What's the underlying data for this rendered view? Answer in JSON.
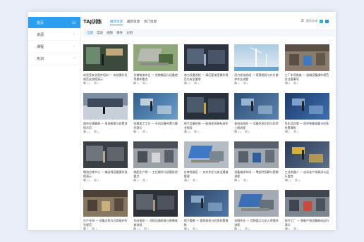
{
  "sidebar": {
    "items": [
      {
        "label": "首页",
        "badge": "15",
        "active": true
      },
      {
        "label": "资源",
        "chevron": "›"
      },
      {
        "label": "课程",
        "chevron": "›"
      },
      {
        "label": "实训",
        "chevron": "›"
      }
    ]
  },
  "header": {
    "title": "TAJ训练",
    "tabs": [
      "推荐资源",
      "最新资源",
      "热门资源"
    ],
    "tools_label": "显示方式",
    "colors": {
      "accent": "#2a9ff0",
      "tool_a": "#2ab3c0",
      "tool_b": "#2a8fe8"
    }
  },
  "filters": [
    "全部",
    "实验",
    "视频",
    "课件",
    "文档"
  ],
  "cards": [
    {
      "desc": "实验室安全防护培训 — 实验操作员规范化流程演示",
      "views": "12",
      "likes": "3",
      "scene": "room",
      "palette": [
        "#3b4a3c",
        "#6b8a6f",
        "#c2a878"
      ]
    },
    {
      "desc": "仓储物流作业 — 货物搬运与设备使用操作要点",
      "views": "8",
      "likes": "2",
      "scene": "aerial",
      "palette": [
        "#4d6b3f",
        "#8fa87a",
        "#b7b8b0"
      ]
    },
    {
      "desc": "电力设备巡检 — 高压配电室操作规范与安全要求",
      "views": "15",
      "likes": "4",
      "scene": "dark",
      "palette": [
        "#2b3340",
        "#56647a",
        "#9ab0c8"
      ]
    },
    {
      "desc": "风力发电机组 — 塔筒巡检与叶片维护作业流程",
      "views": "9",
      "likes": "1",
      "scene": "sky",
      "palette": [
        "#6aa4cc",
        "#a9cbe3",
        "#e9eef2"
      ]
    },
    {
      "desc": "工厂车间巡查 — 机械设备操作规范及注意事项",
      "views": "6",
      "likes": "2",
      "scene": "factory",
      "palette": [
        "#5a4f45",
        "#8a7b6a",
        "#3d7ac0"
      ]
    },
    {
      "desc": "城市交通事故 — 现场勘查与处置流程示范",
      "views": "11",
      "likes": "3",
      "scene": "street",
      "palette": [
        "#3d4a5c",
        "#7d8ea3",
        "#c7d0da"
      ]
    },
    {
      "desc": "金属加工工位 — 车间设备布置与操作演示",
      "views": "7",
      "likes": "1",
      "scene": "blue",
      "palette": [
        "#2f5f8f",
        "#6d9fc9",
        "#d8dfe6"
      ]
    },
    {
      "desc": "电气设备检修 — 配电柜拆装标准作业指导",
      "views": "10",
      "likes": "2",
      "scene": "dark",
      "palette": [
        "#27303b",
        "#4b5a6c",
        "#c9a24a"
      ]
    },
    {
      "desc": "变电站巡检 — 设备状态识别与异常上报流程",
      "views": "13",
      "likes": "5",
      "scene": "blue",
      "palette": [
        "#2d4f78",
        "#5b83ad",
        "#a9c3da"
      ]
    },
    {
      "desc": "危化品存储 — 防护装备穿戴与应急处置演练",
      "views": "5",
      "likes": "1",
      "scene": "blue",
      "palette": [
        "#1e3c6a",
        "#3d6fb0",
        "#8db0d9"
      ]
    },
    {
      "desc": "物流分拣中心 — 输送线设备操作流程演示",
      "views": "14",
      "likes": "3",
      "scene": "dark",
      "palette": [
        "#3a3f46",
        "#6f757d",
        "#b8aa8a"
      ]
    },
    {
      "desc": "装配生产线 — 工位操作与质量检验要点",
      "views": "9",
      "likes": "2",
      "scene": "factory",
      "palette": [
        "#4a4f58",
        "#9aa0a8",
        "#d4d6d8"
      ]
    },
    {
      "desc": "仓库货架区 — 叉车作业与安全通道管理",
      "views": "8",
      "likes": "1",
      "scene": "aerial",
      "palette": [
        "#7b8790",
        "#b3bcc3",
        "#3d79c6"
      ]
    },
    {
      "desc": "设备维修车间 — 零部件拆解与更换流程",
      "views": "6",
      "likes": "2",
      "scene": "factory",
      "palette": [
        "#58616b",
        "#a0a6ad",
        "#2e5e9c"
      ]
    },
    {
      "desc": "工业机器人 — 自动化产线调试与运行监控",
      "views": "12",
      "likes": "4",
      "scene": "blue",
      "palette": [
        "#2c3c58",
        "#5d6f8c",
        "#f0c040"
      ]
    },
    {
      "desc": "生产车间 — 设备点检与日常维护作业规范",
      "views": "7",
      "likes": "1",
      "scene": "factory",
      "palette": [
        "#4b4137",
        "#877660",
        "#c9b27a"
      ]
    },
    {
      "desc": "车间巡检 — 消防设施检查与隐患排查流程",
      "views": "10",
      "likes": "3",
      "scene": "dark",
      "palette": [
        "#2d3138",
        "#5c636d",
        "#a89a7c"
      ]
    },
    {
      "desc": "地下管廊 — 管线巡检与应急处置演练",
      "views": "8",
      "likes": "2",
      "scene": "blue",
      "palette": [
        "#2a4466",
        "#5078a6",
        "#98b4d2"
      ]
    },
    {
      "desc": "仓储作业 — 货物盘点与出入库操作流程",
      "views": "11",
      "likes": "2",
      "scene": "aerial",
      "palette": [
        "#66707a",
        "#a3aab1",
        "#3a6fb3"
      ]
    },
    {
      "desc": "现代工厂 — 智能产线设备联动运行演示",
      "views": "9",
      "likes": "1",
      "scene": "factory",
      "palette": [
        "#3f4650",
        "#7d858f",
        "#c94b3a"
      ]
    }
  ]
}
